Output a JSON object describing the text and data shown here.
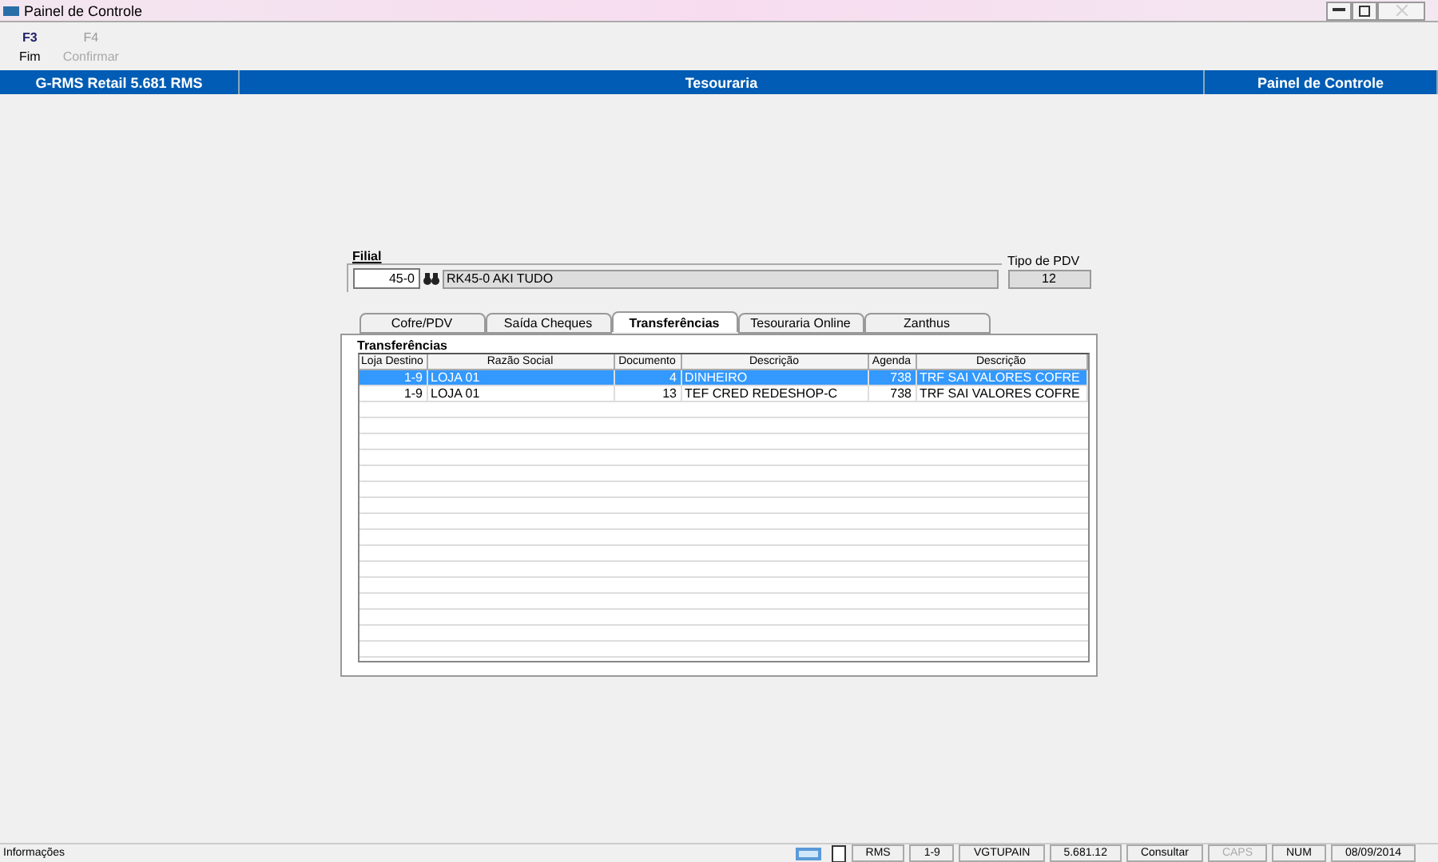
{
  "window": {
    "title": "Painel de Controle"
  },
  "toolbar": [
    {
      "key": "F3",
      "label": "Fim",
      "disabled": false
    },
    {
      "key": "F4",
      "label": "Confirmar",
      "disabled": true
    }
  ],
  "header": {
    "left": "G-RMS Retail 5.681 RMS",
    "center": "Tesouraria",
    "right": "Painel de Controle"
  },
  "filial": {
    "title": "Filial",
    "code": "45-0",
    "name": "RK45-0 AKI TUDO",
    "tipo_label": "Tipo de PDV",
    "tipo_value": "12"
  },
  "tabs": [
    {
      "label": "Cofre/PDV",
      "selected": false
    },
    {
      "label": "Saída Cheques",
      "selected": false
    },
    {
      "label": "Transferências",
      "selected": true
    },
    {
      "label": "Tesouraria Online",
      "selected": false
    },
    {
      "label": "Zanthus",
      "selected": false
    }
  ],
  "group_title": "Transferências",
  "table": {
    "columns": [
      "Loja Destino",
      "Razão Social",
      "Documento",
      "Descrição",
      "Agenda",
      "Descrição"
    ],
    "rows": [
      {
        "cells": [
          "1-9",
          "LOJA 01",
          "4",
          "DINHEIRO",
          "738",
          "TRF SAI VALORES COFRE"
        ],
        "selected": true
      },
      {
        "cells": [
          "1-9",
          "LOJA 01",
          "13",
          "TEF CRED REDESHOP-C",
          "738",
          "TRF SAI VALORES COFRE"
        ],
        "selected": false
      }
    ]
  },
  "status_bar": {
    "message": "Informações",
    "panels": [
      {
        "text": "RMS",
        "disabled": false
      },
      {
        "text": "1-9",
        "disabled": false
      },
      {
        "text": "VGTUPAIN",
        "disabled": false
      },
      {
        "text": "5.681.12",
        "disabled": false
      },
      {
        "text": "Consultar",
        "disabled": false
      },
      {
        "text": "CAPS",
        "disabled": true
      },
      {
        "text": "NUM",
        "disabled": false
      },
      {
        "text": "08/09/2014",
        "disabled": false
      }
    ]
  }
}
